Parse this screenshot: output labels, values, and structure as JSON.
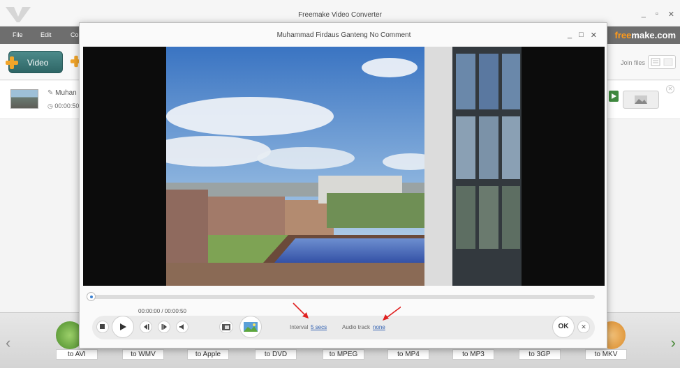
{
  "app": {
    "title": "Freemake Video Converter",
    "minimize": "_",
    "maximize": "▫",
    "close": "✕",
    "brand_main": "free",
    "brand_suffix": "make.com"
  },
  "menu": {
    "file": "File",
    "edit": "Edit",
    "partial": "Co"
  },
  "toolbar": {
    "video_label": "Video",
    "join_label": "Join files"
  },
  "file_row": {
    "name": "Muhan",
    "duration": "00:00:50"
  },
  "formats": [
    "to AVI",
    "to WMV",
    "to Apple",
    "to DVD",
    "to MPEG",
    "to MP4",
    "to MP3",
    "to 3GP",
    "to MKV"
  ],
  "dialog": {
    "title": "Muhammad Firdaus  Ganteng  No Comment",
    "minimize": "_",
    "maximize": "□",
    "close": "✕",
    "time": "00:00:00 / 00:00:50",
    "interval_label": "Interval",
    "interval_value": "5 secs",
    "audio_label": "Audio track",
    "audio_value": "none",
    "ok": "OK",
    "cancel": "✕"
  }
}
